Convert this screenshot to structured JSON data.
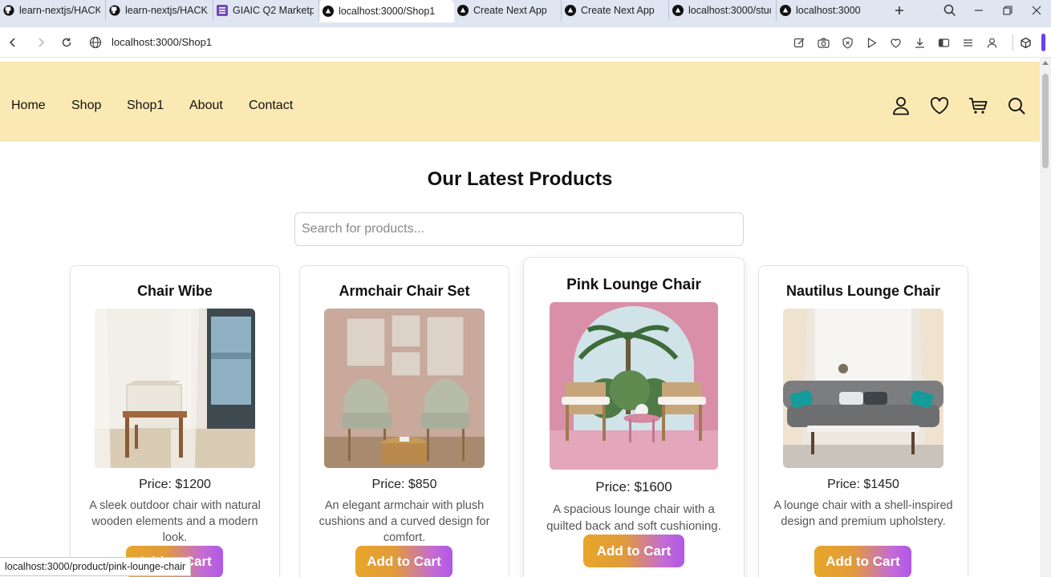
{
  "browser": {
    "tabs": [
      {
        "label": "learn-nextjs/HACKA",
        "icon": "github-icon",
        "active": false
      },
      {
        "label": "learn-nextjs/HACKA",
        "icon": "github-icon",
        "active": false
      },
      {
        "label": "GIAIC Q2 Marketpla",
        "icon": "form-icon",
        "active": false
      },
      {
        "label": "localhost:3000/Shop1",
        "icon": "vercel-icon",
        "active": true
      },
      {
        "label": "Create Next App",
        "icon": "vercel-icon",
        "active": false
      },
      {
        "label": "Create Next App",
        "icon": "vercel-icon",
        "active": false
      },
      {
        "label": "localhost:3000/stud",
        "icon": "vercel-icon",
        "active": false
      },
      {
        "label": "localhost:3000",
        "icon": "vercel-icon",
        "active": false
      }
    ],
    "url": "localhost:3000/Shop1",
    "status_url": "localhost:3000/product/pink-lounge-chair",
    "accent_color": "#6a3ef5"
  },
  "site": {
    "header_bg": "#fbe9b3",
    "nav": [
      "Home",
      "Shop",
      "Shop1",
      "About",
      "Contact"
    ],
    "icons": [
      "user-icon",
      "heart-icon",
      "cart-icon",
      "search-icon"
    ]
  },
  "main": {
    "title": "Our Latest Products",
    "search_placeholder": "Search for products...",
    "products": [
      {
        "name": "Chair Wibe",
        "price": "Price: $1200",
        "description": "A sleek outdoor chair with natural wooden elements and a modern look.",
        "button": "Add to Cart"
      },
      {
        "name": "Armchair Chair Set",
        "price": "Price: $850",
        "description": "An elegant armchair with plush cushions and a curved design for comfort.",
        "button": "Add to Cart"
      },
      {
        "name": "Pink Lounge Chair",
        "price": "Price: $1600",
        "description": "A spacious lounge chair with a quilted back and soft cushioning.",
        "button": "Add to Cart"
      },
      {
        "name": "Nautilus Lounge Chair",
        "price": "Price: $1450",
        "description": "A lounge chair with a shell-inspired design and premium upholstery.",
        "button": "Add to Cart"
      }
    ],
    "button_gradient": [
      "#e7a62a",
      "#b058e6"
    ]
  }
}
